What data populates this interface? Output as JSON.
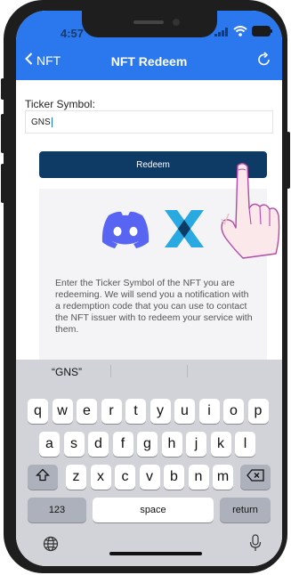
{
  "status_bar": {
    "time": "4:57"
  },
  "nav": {
    "back_label": "NFT",
    "title": "NFT Redeem"
  },
  "form": {
    "ticker_label": "Ticker Symbol:",
    "ticker_value": "GNS"
  },
  "redeem_button": {
    "label": "Redeem"
  },
  "info_text": "Enter the Ticker Symbol of the NFT you are redeeming. We will send you a notification with a redemption code that you can use to contact the NFT issuer with to redeem your service with them.",
  "keyboard": {
    "suggestion": "“GNS”",
    "row1": [
      "q",
      "w",
      "e",
      "r",
      "t",
      "y",
      "u",
      "i",
      "o",
      "p"
    ],
    "row2": [
      "a",
      "s",
      "d",
      "f",
      "g",
      "h",
      "j",
      "k",
      "l"
    ],
    "row3": [
      "z",
      "x",
      "c",
      "v",
      "b",
      "n",
      "m"
    ],
    "numbers_label": "123",
    "space_label": "space",
    "return_label": "return"
  },
  "colors": {
    "nav_blue": "#2b78ee",
    "redeem_navy": "#0d3b66",
    "discord": "#5865f2",
    "nft_logo": "#29a9e1"
  }
}
